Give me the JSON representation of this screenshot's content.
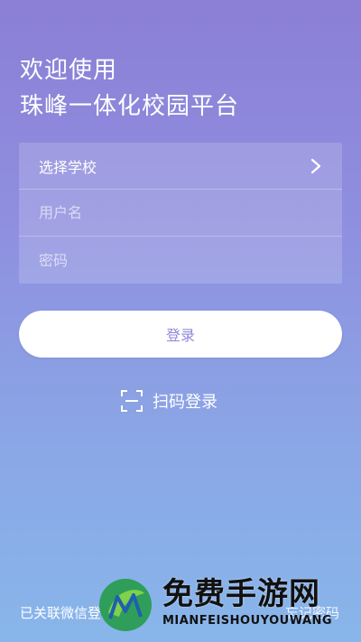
{
  "header": {
    "line1": "欢迎使用",
    "line2": "珠峰一体化校园平台"
  },
  "form": {
    "school_select_label": "选择学校",
    "username_placeholder": "用户名",
    "password_placeholder": "密码"
  },
  "actions": {
    "login_label": "登录",
    "scan_login_label": "扫码登录"
  },
  "footer": {
    "wechat_link": "已关联微信登录",
    "forgot_password": "忘记密码"
  },
  "watermark": {
    "title": "免费手游网",
    "subtitle": "MIANFEISHOUYOUWANG"
  },
  "icons": {
    "chevron": "chevron-right-icon",
    "scan": "scan-qr-icon",
    "logo": "m-leaf-logo"
  },
  "colors": {
    "gradient_top": "#8b7fd6",
    "gradient_bottom": "#88b6ea",
    "button_text": "#8f88d8"
  }
}
